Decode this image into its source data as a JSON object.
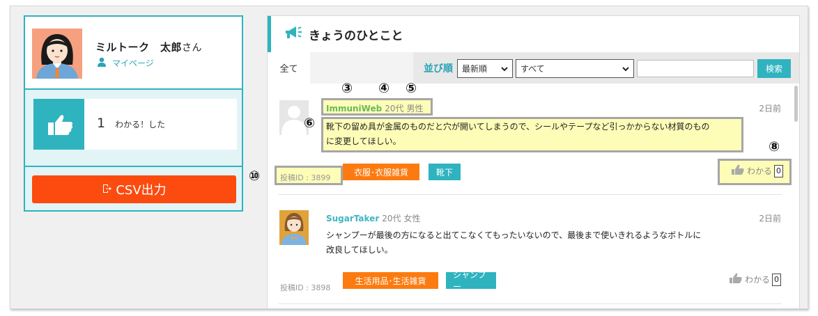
{
  "profile": {
    "name": "ミルトーク　太郎",
    "honorific": "さん",
    "mypage_label": "マイページ",
    "like_count": "1",
    "like_label": "わかる！した",
    "csv_button": "CSV出力"
  },
  "main": {
    "title": "きょうのひとこと",
    "tab_all": "全て",
    "sort_label": "並び順",
    "sort_select": "最新順",
    "category_select": "すべて",
    "search_value": "",
    "search_button": "検索"
  },
  "posts": [
    {
      "author": "ImmuniWeb",
      "age": "20代",
      "gender": "男性",
      "date": "2日前",
      "body": "靴下の留め具が金属のものだと穴が開いてしまうので、シールやテープなど引っかからない材質のものに変更してほしい。",
      "post_id": "投稿ID : 3899",
      "tags": [
        "衣服･衣服雑貨",
        "靴下"
      ],
      "like_label": "わかる",
      "like_count": "0"
    },
    {
      "author": "SugarTaker",
      "age": "20代",
      "gender": "女性",
      "date": "2日前",
      "body": "シャンプーが最後の方になると出てこなくてもったいないので、最後まで使いきれるようなボトルに改良してほしい。",
      "post_id": "投稿ID : 3898",
      "tags": [
        "生活用品･生活雑貨",
        "シャンプー"
      ],
      "like_label": "わかる",
      "like_count": "0"
    }
  ],
  "annotations": {
    "m3": "③",
    "m4": "④",
    "m5": "⑤",
    "m6": "⑥",
    "m8": "⑧",
    "m10": "⑩"
  },
  "colors": {
    "accent": "#2fb3bf",
    "csv_button": "#fc4b0f",
    "tag_orange": "#fc7b10",
    "highlight": "#fdfdb8"
  }
}
